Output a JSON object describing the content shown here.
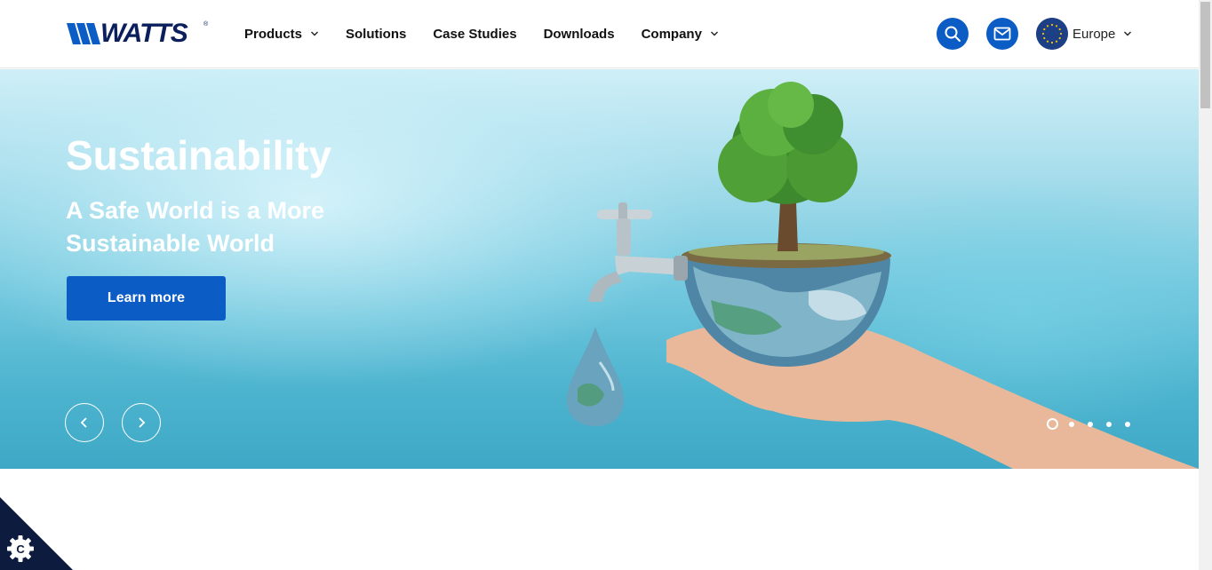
{
  "header": {
    "logo_text": "WATTS",
    "logo_reg": "®",
    "nav": [
      {
        "label": "Products",
        "has_dropdown": true
      },
      {
        "label": "Solutions",
        "has_dropdown": false
      },
      {
        "label": "Case Studies",
        "has_dropdown": false
      },
      {
        "label": "Downloads",
        "has_dropdown": false
      },
      {
        "label": "Company",
        "has_dropdown": true
      }
    ],
    "search_icon": "search-icon",
    "contact_icon": "mail-icon",
    "region": {
      "label": "Europe",
      "flag_icon": "eu-flag-icon"
    }
  },
  "hero": {
    "title": "Sustainability",
    "subtitle": "A Safe World is a More Sustainable World",
    "cta_label": "Learn more",
    "prev_icon": "chevron-left-icon",
    "next_icon": "chevron-right-icon",
    "slide_count": 5,
    "active_slide": 1
  },
  "cookie": {
    "icon": "cookie-settings-icon",
    "letter": "C"
  },
  "colors": {
    "brand_blue": "#0b5cc5",
    "logo_navy": "#0a1f5c",
    "cookie_bg": "#0d1b3e"
  }
}
